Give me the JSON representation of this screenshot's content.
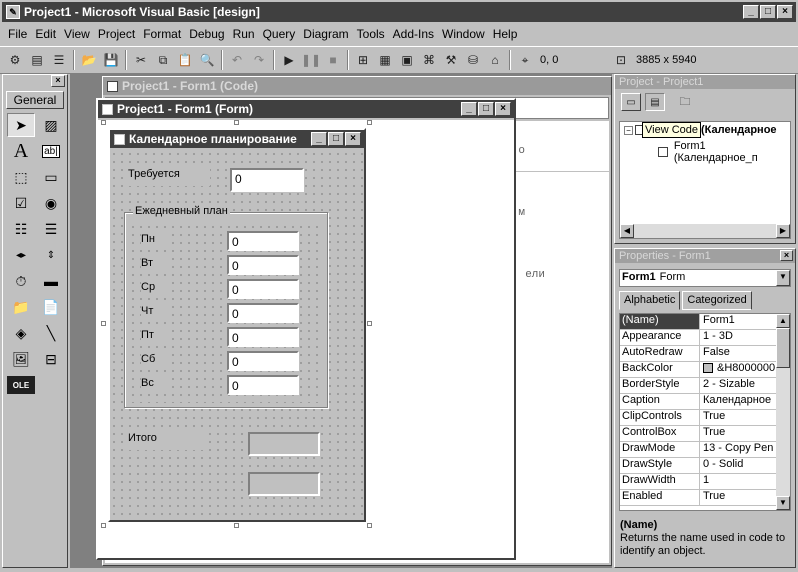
{
  "app": {
    "title": "Project1 - Microsoft Visual Basic [design]"
  },
  "menu": [
    "File",
    "Edit",
    "View",
    "Project",
    "Format",
    "Debug",
    "Run",
    "Query",
    "Diagram",
    "Tools",
    "Add-Ins",
    "Window",
    "Help"
  ],
  "toolbar": {
    "coords": "0, 0",
    "size": "3885 x 5940"
  },
  "toolbox": {
    "tab_label": "General"
  },
  "code_window": {
    "title": "Project1 - Form1 (Code)",
    "fragments": [
      "о",
      "м",
      "ели"
    ]
  },
  "form_window": {
    "title": "Project1 - Form1 (Form)"
  },
  "form": {
    "caption": "Календарное планирование",
    "required_label": "Требуется",
    "required_value": "0",
    "frame_label": "Ежедневный план",
    "days": [
      {
        "label": "Пн",
        "value": "0"
      },
      {
        "label": "Вт",
        "value": "0"
      },
      {
        "label": "Ср",
        "value": "0"
      },
      {
        "label": "Чт",
        "value": "0"
      },
      {
        "label": "Пт",
        "value": "0"
      },
      {
        "label": "Сб",
        "value": "0"
      },
      {
        "label": "Вс",
        "value": "0"
      }
    ],
    "total_label": "Итого"
  },
  "project": {
    "title": "Project - Project1",
    "tooltip": "View Code",
    "root_label": "(Календарное",
    "child_label": "Form1 (Календарное_п"
  },
  "properties": {
    "title": "Properties - Form1",
    "object_name": "Form1",
    "object_type": "Form",
    "tabs": [
      "Alphabetic",
      "Categorized"
    ],
    "rows": [
      {
        "name": "(Name)",
        "value": "Form1"
      },
      {
        "name": "Appearance",
        "value": "1 - 3D"
      },
      {
        "name": "AutoRedraw",
        "value": "False"
      },
      {
        "name": "BackColor",
        "value": "&H8000000"
      },
      {
        "name": "BorderStyle",
        "value": "2 - Sizable"
      },
      {
        "name": "Caption",
        "value": "Календарное"
      },
      {
        "name": "ClipControls",
        "value": "True"
      },
      {
        "name": "ControlBox",
        "value": "True"
      },
      {
        "name": "DrawMode",
        "value": "13 - Copy Pen"
      },
      {
        "name": "DrawStyle",
        "value": "0 - Solid"
      },
      {
        "name": "DrawWidth",
        "value": "1"
      },
      {
        "name": "Enabled",
        "value": "True"
      }
    ],
    "desc_title": "(Name)",
    "desc_text": "Returns the name used in code to identify an object."
  },
  "colors": {
    "title_active": "#404040",
    "title_inactive": "#9a9a9a",
    "selection": "#404040",
    "face": "#c0c0c0"
  }
}
